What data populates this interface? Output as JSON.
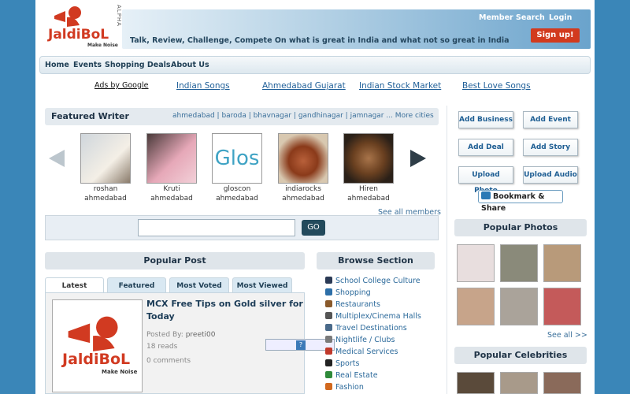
{
  "header": {
    "logo_text": "JaldiBoL",
    "logo_tagline": "Make Noise",
    "alpha_label": "ALPHA",
    "tagline": "Talk, Review, Challenge, Compete On what is great in India and what not so great in India",
    "member_search": "Member Search",
    "login": "Login",
    "signup": "Sign up!"
  },
  "nav": {
    "items": [
      "Home",
      "Events",
      "Shopping Deals",
      "About Us"
    ]
  },
  "ads": {
    "label": "Ads by Google",
    "links": [
      "Indian Songs",
      "Ahmedabad Gujarat",
      "Indian Stock Market",
      "Best Love Songs"
    ]
  },
  "featured": {
    "title": "Featured Writer",
    "cities": "ahmedabad | baroda | bhavnagar | gandhinagar | jamnagar ... More cities",
    "writers": [
      {
        "name": "roshan",
        "city": "ahmedabad"
      },
      {
        "name": "Kruti",
        "city": "ahmedabad"
      },
      {
        "name": "gloscon",
        "city": "ahmedabad"
      },
      {
        "name": "indiarocks",
        "city": "ahmedabad"
      },
      {
        "name": "Hiren",
        "city": "ahmedabad"
      }
    ],
    "thumb_text": "Glos",
    "see_all": "See all members"
  },
  "search": {
    "go_label": "GO"
  },
  "popular_post": {
    "title": "Popular Post",
    "tabs": [
      "Latest",
      "Featured",
      "Most Voted",
      "Most Viewed"
    ],
    "post_title": "MCX Free Tips on Gold silver for Today",
    "posted_by_label": "Posted By:",
    "posted_by": "preeti00",
    "reads": "18 reads",
    "comments": "0 comments",
    "rating_mark": "?"
  },
  "browse": {
    "title": "Browse Section",
    "items": [
      {
        "label": "School College Culture",
        "color": "#2b3a55"
      },
      {
        "label": "Shopping",
        "color": "#2d6fa8"
      },
      {
        "label": "Restaurants",
        "color": "#8a5a2b"
      },
      {
        "label": "Multiplex/Cinema Halls",
        "color": "#555555"
      },
      {
        "label": "Travel Destinations",
        "color": "#4a6a8a"
      },
      {
        "label": "Nightlife / Clubs",
        "color": "#7a7a7a"
      },
      {
        "label": "Medical Services",
        "color": "#c0392b"
      },
      {
        "label": "Sports",
        "color": "#222222"
      },
      {
        "label": "Real Estate",
        "color": "#2f8a3a"
      },
      {
        "label": "Fashion",
        "color": "#d2691e"
      }
    ]
  },
  "actions": [
    "Add Business",
    "Add Event",
    "Add Deal",
    "Add Story",
    "Upload Photo",
    "Upload Audio"
  ],
  "bookmark": "Bookmark & Share",
  "photos": {
    "title": "Popular Photos",
    "see_all": "See all >>",
    "tiles": [
      "#e8dede",
      "#8a8a7a",
      "#b89a7a",
      "#c7a48a",
      "#aaa39a",
      "#c45a5a"
    ]
  },
  "celebrities": {
    "title": "Popular Celebrities",
    "tiles": [
      "#5a4a3a",
      "#a89a8a",
      "#8a6a5a"
    ]
  },
  "colors": {
    "accent": "#d23a1e",
    "link": "#2c6a9b",
    "page_bg": "#3a86b8"
  }
}
